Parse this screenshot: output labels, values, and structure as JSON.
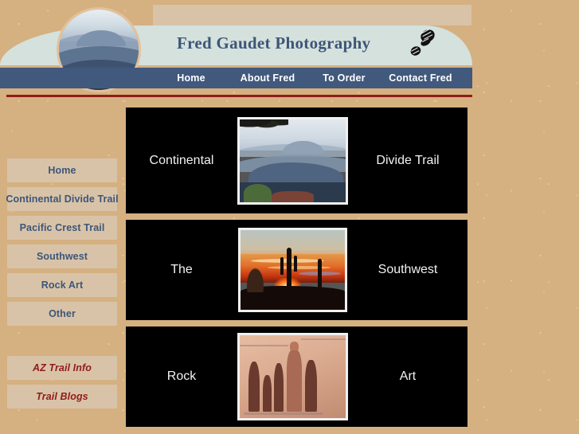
{
  "header": {
    "site_title": "Fred Gaudet Photography",
    "boot_icon": "boot-print-icon",
    "medallion_alt": "mountain-landscape-photo",
    "nav": [
      {
        "label": "Home"
      },
      {
        "label": "About Fred"
      },
      {
        "label": "To Order"
      },
      {
        "label": "Contact Fred"
      }
    ]
  },
  "sidebar": {
    "items": [
      {
        "label": "Home",
        "style": "normal"
      },
      {
        "label": "Continental Divide Trail",
        "style": "normal"
      },
      {
        "label": "Pacific Crest Trail",
        "style": "normal"
      },
      {
        "label": "Southwest",
        "style": "normal"
      },
      {
        "label": "Rock Art",
        "style": "normal"
      },
      {
        "label": "Other",
        "style": "normal"
      }
    ],
    "extra_items": [
      {
        "label": "AZ Trail Info",
        "style": "alt"
      },
      {
        "label": "Trail Blogs",
        "style": "alt"
      }
    ]
  },
  "main": {
    "panels": [
      {
        "left_text": "Continental",
        "right_text": "Divide Trail",
        "thumb_alt": "hazy-mountain-ridges-photo"
      },
      {
        "left_text": "The",
        "right_text": "Southwest",
        "thumb_alt": "saguaro-cactus-sunset-photo"
      },
      {
        "left_text": "Rock",
        "right_text": "Art",
        "thumb_alt": "pictograph-rock-art-photo"
      }
    ]
  },
  "colors": {
    "page_background": "#d5b081",
    "banner_panel": "#d5e1dd",
    "navbar": "#41597d",
    "title_text": "#3d5678",
    "accent_rule": "#8e1d18",
    "button_face": "#d9c3a8",
    "panel_background": "#000000"
  }
}
